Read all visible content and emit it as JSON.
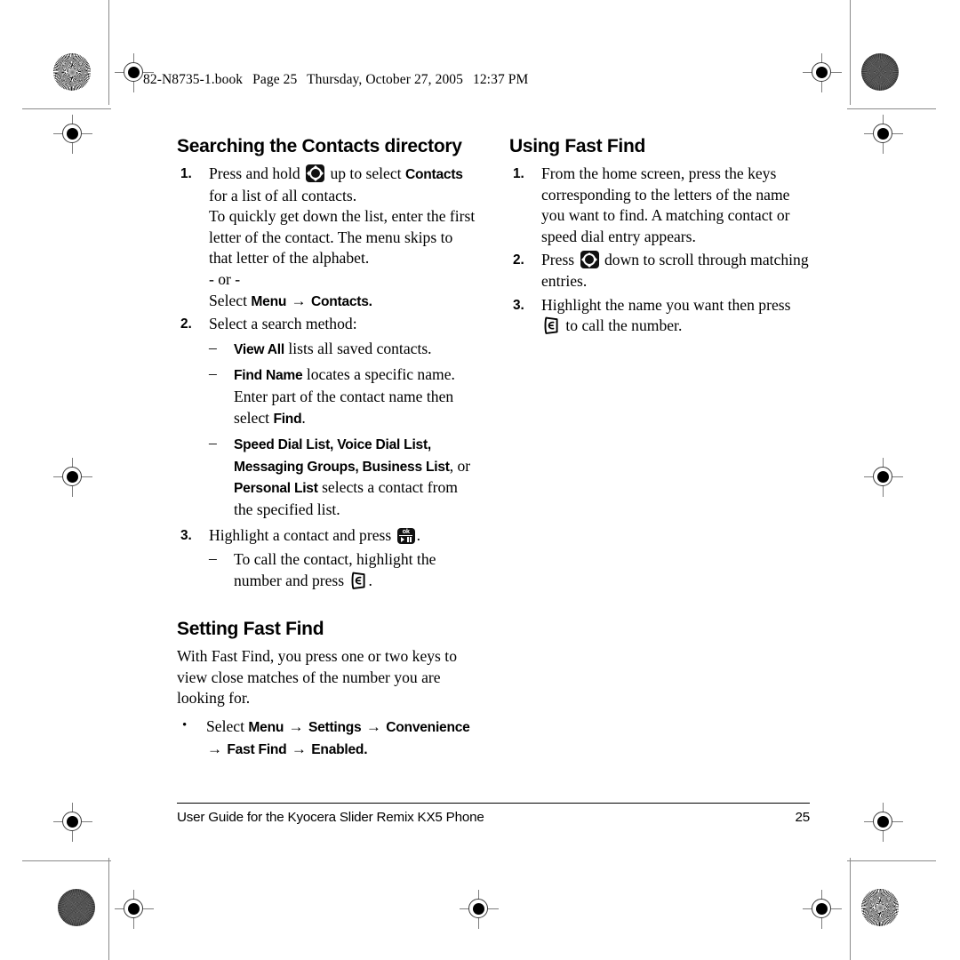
{
  "header": {
    "slug_parts": [
      "82-N8735-1.book",
      "Page 25",
      "Thursday, October 27, 2005",
      "12:37 PM"
    ]
  },
  "left_column": {
    "section1": {
      "title": "Searching the Contacts directory",
      "steps": [
        {
          "number": "1.",
          "lead_before": "Press and hold",
          "icon": "nav-key-icon",
          "lead_mid": "up to select",
          "term": "Contacts",
          "lead_after": "for a list of all contacts.",
          "paragraph": "To quickly get down the list, enter the first letter of the contact. The menu skips to that letter of the alphabet.",
          "or_label": "- or -",
          "alt_prefix": "Select",
          "alt_term1": "Menu",
          "alt_arrow": "→",
          "alt_term2": "Contacts",
          "alt_suffix": "."
        },
        {
          "number": "2.",
          "text": "Select a search method:",
          "sub_items": [
            {
              "dash": "–",
              "term": "View All",
              "text": " lists all saved contacts."
            },
            {
              "dash": "–",
              "term": "Find Name",
              "text": " locates a specific name. Enter part of the contact name then select ",
              "term2": "Find",
              "text2": "."
            },
            {
              "dash": "–",
              "term": "Speed Dial List",
              "sep1": ", ",
              "term2": "Voice Dial List",
              "sep2": ", ",
              "term3": "Messaging Groups",
              "sep3": ", ",
              "term4": "Business List",
              "sep4": ", or ",
              "term5": "Personal List",
              "text": " selects a contact from the specified list."
            }
          ]
        },
        {
          "number": "3.",
          "text_before": "Highlight a contact and press",
          "icon": "ok-key-icon",
          "text_after": ".",
          "sub_items": [
            {
              "dash": "–",
              "text_before": "To call the contact, highlight the number and press",
              "icon": "send-key-icon",
              "text_after": "."
            }
          ]
        }
      ]
    },
    "section2": {
      "title": "Setting Fast Find",
      "paragraph": "With Fast Find, you press one or two keys to view close matches of the number you are looking for.",
      "bullet": {
        "symbol": "•",
        "prefix": "Select",
        "term1": "Menu",
        "arrow1": "→",
        "term2": "Settings",
        "arrow2": "→",
        "term3": "Convenience",
        "arrow3": "→",
        "term4": "Fast Find",
        "arrow4": "→",
        "term5": "Enabled",
        "suffix": "."
      }
    }
  },
  "right_column": {
    "section1": {
      "title": "Using Fast Find",
      "steps": [
        {
          "number": "1.",
          "text": "From the home screen, press the keys corresponding to the letters of the name you want to find. A matching contact or speed dial entry appears."
        },
        {
          "number": "2.",
          "text_before": "Press",
          "icon": "nav-key-icon",
          "text_after": "down to scroll through matching entries."
        },
        {
          "number": "3.",
          "text_before": "Highlight the name you want then press",
          "icon": "send-key-icon",
          "text_after": "to call the number."
        }
      ]
    }
  },
  "footer": {
    "text": "User Guide for the Kyocera Slider Remix KX5 Phone",
    "page_number": "25"
  },
  "printer_marks": {
    "burst_label": "radial-burst-target",
    "patch_label": "gray-density-patch",
    "registration_label": "registration-target"
  },
  "colors": {
    "text": "#000000",
    "trim_line": "#8a8a8a",
    "registration": "#3b3b3b"
  }
}
